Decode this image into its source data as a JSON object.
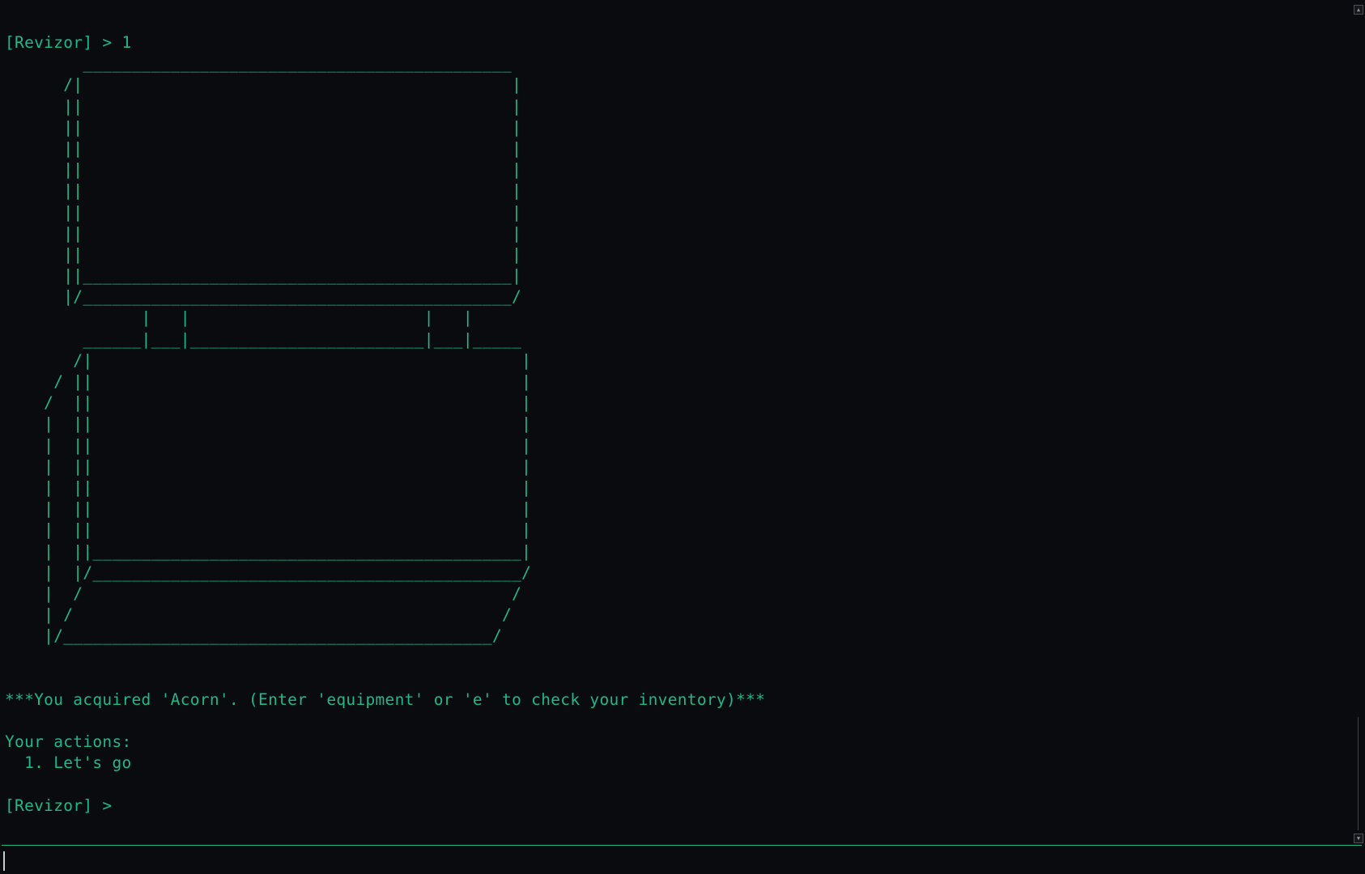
{
  "terminal": {
    "lines": [
      "[Revizor] > 1",
      "        ____________________________________________",
      "      /|                                            |",
      "      ||                                            |",
      "      ||                                            |",
      "      ||                                            |",
      "      ||                                            |",
      "      ||                                            |",
      "      ||                                            |",
      "      ||                                            |",
      "      ||                                            |",
      "      ||____________________________________________|",
      "      |/____________________________________________/",
      "              |   |                        |   |",
      "        ______|___|________________________|___|_____",
      "       /|                                            |",
      "     / ||                                            |",
      "    /  ||                                            |",
      "    |  ||                                            |",
      "    |  ||                                            |",
      "    |  ||                                            |",
      "    |  ||                                            |",
      "    |  ||                                            |",
      "    |  ||                                            |",
      "    |  ||____________________________________________|",
      "    |  |/____________________________________________/",
      "    |  /                                            /",
      "    | /                                            /",
      "    |/____________________________________________/",
      "",
      "",
      "***You acquired 'Acorn'. (Enter 'equipment' or 'e' to check your inventory)***",
      "",
      "Your actions:",
      "  1. Let's go",
      "",
      "[Revizor] >"
    ]
  },
  "scrollbar": {
    "up_glyph": "▲",
    "down_glyph": "▼"
  },
  "input": {
    "value": ""
  },
  "colors": {
    "background": "#0a0b0e",
    "text": "#1fb887",
    "divider": "#1fb887"
  }
}
